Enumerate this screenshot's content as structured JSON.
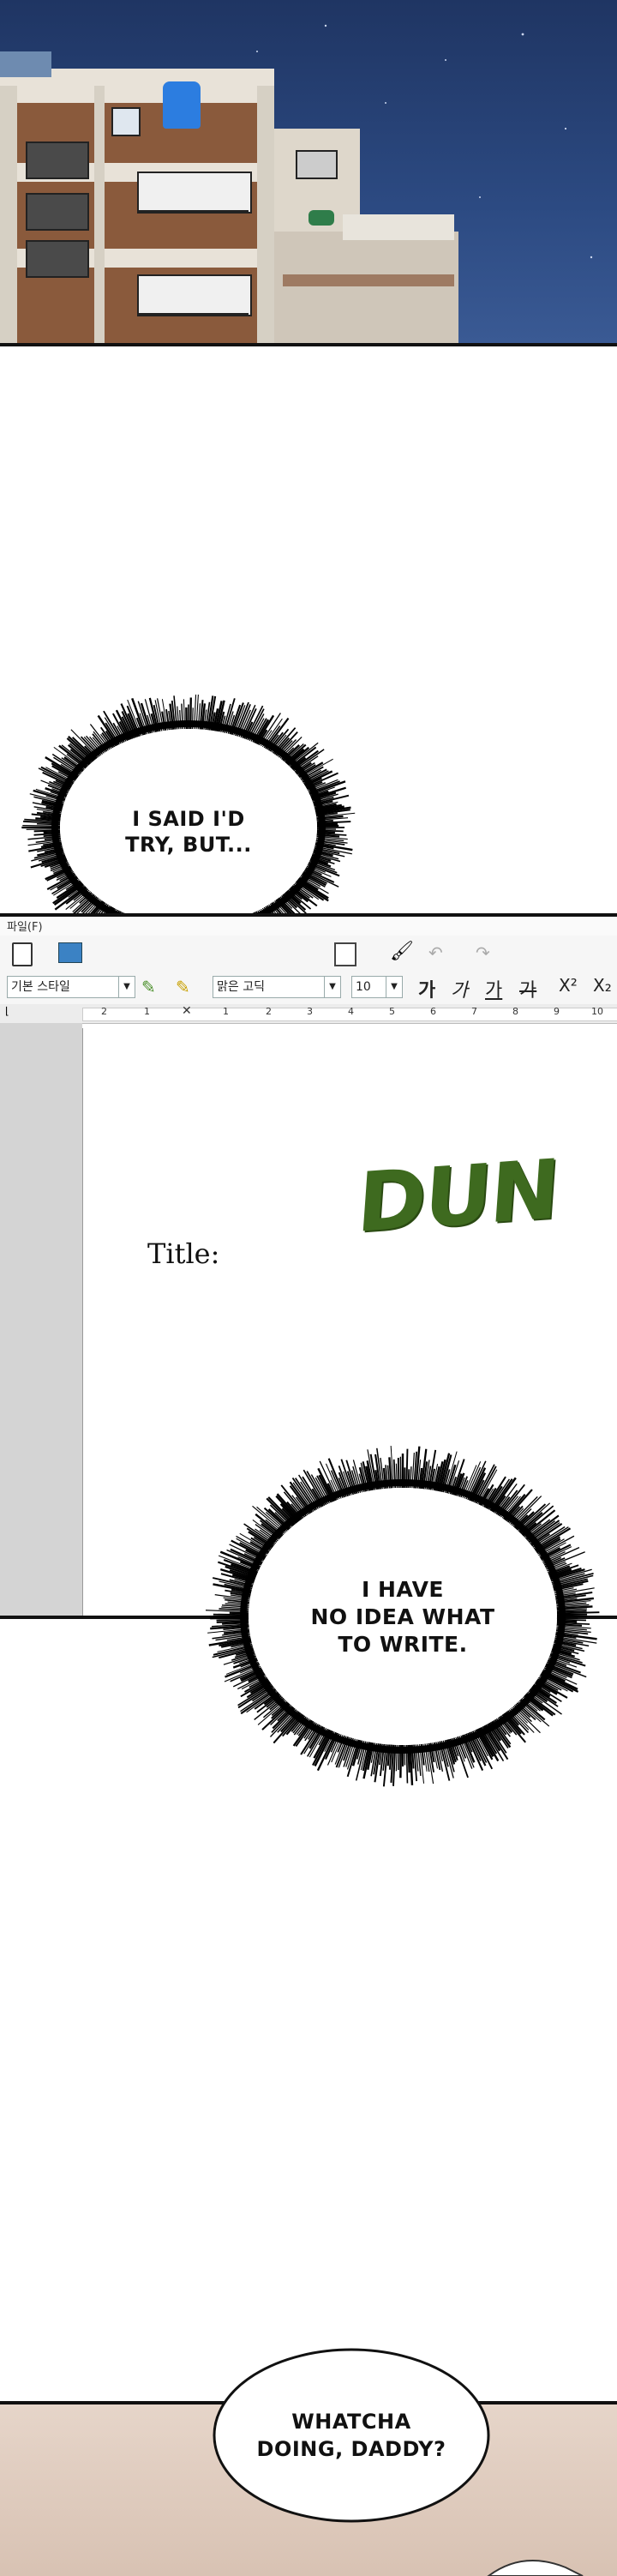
{
  "bubbles": {
    "first": [
      "I SAID I'D",
      "TRY, BUT..."
    ],
    "second": [
      "I HAVE",
      "NO IDEA WHAT",
      "TO WRITE."
    ],
    "third": [
      "WHATCHA",
      "DOING, DADDY?"
    ]
  },
  "editor": {
    "menu_fragment": "파일(F)",
    "paragraph_style": "기본 스타일",
    "font_name": "맑은 고딕",
    "font_size": "10",
    "format_buttons": [
      "가",
      "가",
      "가",
      "가"
    ],
    "superscript": "X²",
    "subscript": "X₂",
    "doc_title_label": "Title:",
    "sfx": "DUN",
    "ruler_numbers": [
      "2",
      "1",
      "1",
      "2",
      "3",
      "4",
      "5",
      "6",
      "7",
      "8",
      "9",
      "10"
    ]
  },
  "colors": {
    "sky": "#2c4a82",
    "sfx_green": "#3e6a1f"
  }
}
